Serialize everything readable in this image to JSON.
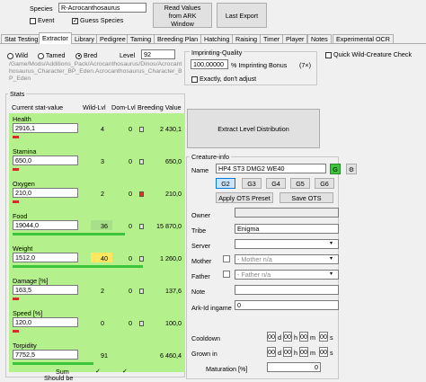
{
  "header": {
    "species_label": "Species",
    "species_value": "R-Acrocanthosaurus",
    "event_label": "Event",
    "guess_species_label": "Guess Species",
    "read_values_label": "Read Values from ARK Window",
    "last_export_label": "Last Export"
  },
  "tabs": [
    "Stat Testing",
    "Extractor",
    "Library",
    "Pedigree",
    "Taming",
    "Breeding Plan",
    "Hatching",
    "Raising",
    "Timer",
    "Player",
    "Notes",
    "Experimental OCR"
  ],
  "options": {
    "wild": "Wild",
    "tamed": "Tamed",
    "bred": "Bred",
    "level_label": "Level",
    "level_value": "92",
    "path": "/Game/Mods/Additions_Pack/Acrocanthosaurus/Dinos/Acrocanthosaurus_Character_BP_Eden.Acrocanthosaurus_Character_BP_Eden"
  },
  "imprinting": {
    "title": "Imprinting-Quality",
    "value": "100,00000",
    "bonus_label": "% Imprinting Bonus",
    "bonus_multiplier": "(7×)",
    "exactly_label": "Exactly, don't adjust"
  },
  "quick_wild_label": "Quick Wild-Creature Check",
  "extract_label": "Extract Level Distribution",
  "stats_panel": {
    "title": "Stats",
    "col_current": "Current stat-value",
    "col_wild": "Wild-Lvl",
    "col_dom": "Dom-Lvl",
    "col_breeding": "Breeding Value",
    "rows": [
      {
        "name": "Health",
        "value": "2916,1",
        "wild": "4",
        "dom": "0",
        "breeding": "2 430,1"
      },
      {
        "name": "Stamina",
        "value": "650,0",
        "wild": "3",
        "dom": "0",
        "breeding": "650,0"
      },
      {
        "name": "Oxygen",
        "value": "210,0",
        "wild": "2",
        "dom": "0",
        "breeding": "210,0"
      },
      {
        "name": "Food",
        "value": "19044,0",
        "wild": "36",
        "dom": "0",
        "breeding": "15 870,0"
      },
      {
        "name": "Weight",
        "value": "1512,0",
        "wild": "40",
        "dom": "0",
        "breeding": "1 260,0"
      },
      {
        "name": "Damage [%]",
        "value": "163,5",
        "wild": "2",
        "dom": "0",
        "breeding": "137,6"
      },
      {
        "name": "Speed [%]",
        "value": "120,0",
        "wild": "0",
        "dom": "0",
        "breeding": "100,0"
      },
      {
        "name": "Torpidity",
        "value": "7752,5",
        "wild": "91",
        "dom": "",
        "breeding": "6 460,4"
      }
    ],
    "sum_label": "Sum",
    "should_be_label": "Should be",
    "sum_check": "✓",
    "sum_dom_check": "✓"
  },
  "creature_info": {
    "title": "Creature-info",
    "name_label": "Name",
    "name_value": "HP4 ST3 DMG2 WE40",
    "g_label": "G",
    "gear_icon": "gear-icon",
    "gen_buttons": [
      "G2",
      "G3",
      "G4",
      "G5",
      "G6"
    ],
    "apply_ots_label": "Apply OTS Preset",
    "save_ots_label": "Save OTS",
    "owner_label": "Owner",
    "tribe_label": "Tribe",
    "tribe_value": "Enigma",
    "server_label": "Server",
    "mother_label": "Mother",
    "mother_placeholder": "- Mother n/a",
    "father_label": "Father",
    "father_placeholder": "- Father n/a",
    "note_label": "Note",
    "ark_id_label": "Ark-Id ingame",
    "ark_id_value": "0",
    "cooldown_label": "Cooldown",
    "grown_label": "Grown in",
    "maturation_label": "Maturation [%]",
    "maturation_value": "0",
    "time_zero": "00",
    "unit_d": "d",
    "unit_h": "h",
    "unit_m": "m",
    "unit_s": "s"
  },
  "colors": {
    "stat_green": "#b4f08c",
    "wild_yellow": "#ffe760",
    "wild_green": "#a8e08a",
    "accent_green": "#3dc43d",
    "gen_blue": "#cce4f7"
  }
}
